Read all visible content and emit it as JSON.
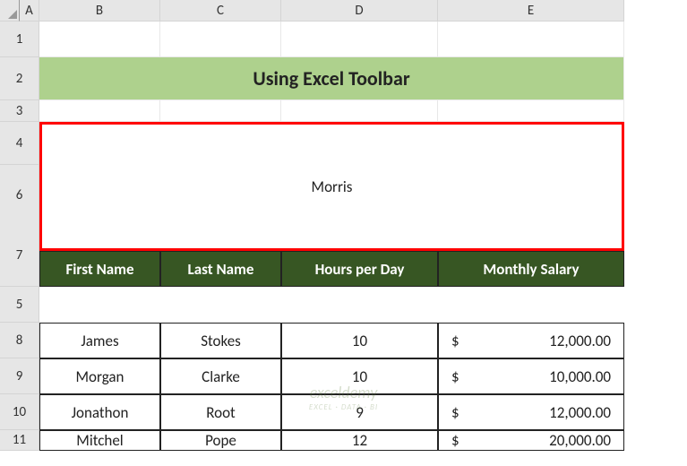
{
  "columns": [
    "",
    "A",
    "B",
    "C",
    "D",
    "E"
  ],
  "rows": [
    "1",
    "2",
    "3",
    "4",
    "5",
    "6",
    "7",
    "8",
    "9",
    "10",
    "11"
  ],
  "title": "Using Excel Toolbar",
  "headers": {
    "first_name": "First Name",
    "last_name": "Last Name",
    "hours": "Hours per Day",
    "salary": "Monthly Salary"
  },
  "merged_value": "Morris",
  "data": [
    {
      "first": "James",
      "last": "Stokes",
      "hours": "10",
      "salary": "12,000.00"
    },
    {
      "first": "Morgan",
      "last": "Clarke",
      "hours": "10",
      "salary": "10,000.00"
    },
    {
      "first": "Jonathon",
      "last": "Root",
      "hours": "9",
      "salary": "12,000.00"
    },
    {
      "first": "Mitchel",
      "last": "Pope",
      "hours": "12",
      "salary": "20,000.00"
    }
  ],
  "currency": "$",
  "watermark": {
    "main": "exceldemy",
    "sub": "EXCEL · DATA · BI"
  },
  "chart_data": {
    "type": "table",
    "title": "Using Excel Toolbar",
    "columns": [
      "First Name",
      "Last Name",
      "Hours per Day",
      "Monthly Salary"
    ],
    "rows": [
      [
        "Morris",
        "",
        "",
        ""
      ],
      [
        "James",
        "Stokes",
        10,
        12000.0
      ],
      [
        "Morgan",
        "Clarke",
        10,
        10000.0
      ],
      [
        "Jonathon",
        "Root",
        9,
        12000.0
      ],
      [
        "Mitchel",
        "Pope",
        12,
        20000.0
      ]
    ]
  }
}
